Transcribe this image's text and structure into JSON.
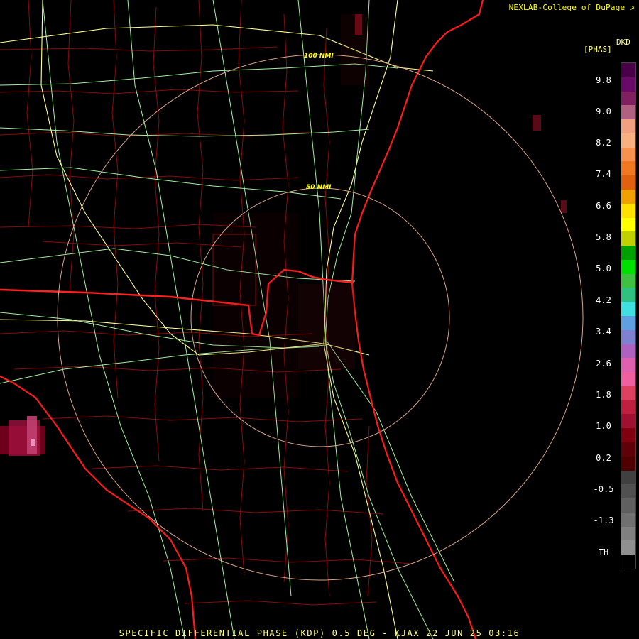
{
  "header": {
    "credit": "NEXLAB-College of DuPage",
    "credit_icon": "external-link-icon"
  },
  "footer": {
    "product_label": "SPECIFIC DIFFERENTIAL PHASE (KDP) 0.5 DEG - KJAX 22 JUN 25 03:16"
  },
  "map": {
    "range_rings": [
      {
        "label": "100 NMI"
      },
      {
        "label": "50 NMI"
      }
    ],
    "colors": {
      "background": "#000000",
      "state_borders": "#ff2020",
      "county_borders": "#b01010",
      "coastline": "#ff1a1a",
      "highways": "#a0f0a0",
      "interstates": "#ffff90",
      "range_rings": "#ffc0a0"
    }
  },
  "legend": {
    "product": "DKD",
    "units": "[PHAS]",
    "ticks": [
      "9.8",
      "9.0",
      "8.2",
      "7.4",
      "6.6",
      "5.8",
      "5.0",
      "4.2",
      "3.4",
      "2.6",
      "1.8",
      "1.0",
      "0.2",
      "-0.5",
      "-1.3",
      "TH"
    ],
    "colors": [
      "#4a0048",
      "#6a0a68",
      "#802060",
      "#b06080",
      "#f0a080",
      "#f8b080",
      "#f89050",
      "#f07820",
      "#e06010",
      "#f0a000",
      "#ffe000",
      "#ffff00",
      "#c0d000",
      "#00a000",
      "#00e000",
      "#40c040",
      "#30c080",
      "#40e0e0",
      "#60a0e0",
      "#8080d0",
      "#b060c0",
      "#e060b0",
      "#f060a0",
      "#e04060",
      "#c02040",
      "#a01030",
      "#800010",
      "#600008",
      "#500000",
      "#404040",
      "#505050",
      "#606060",
      "#707070",
      "#808080",
      "#909090",
      "#000000"
    ]
  }
}
